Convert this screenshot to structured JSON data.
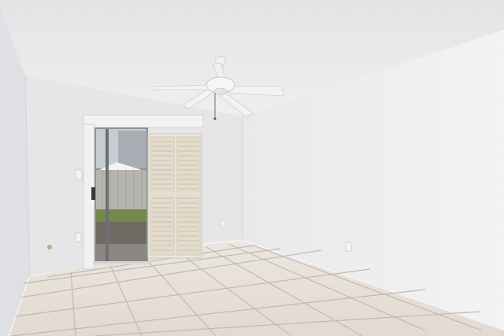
{
  "scene": {
    "description_free": true,
    "colors": {
      "ceiling": "#ececed",
      "wall_back": "#e7e7ea",
      "wall_right": "#eeeef0",
      "wall_left": "#dedfe2",
      "floor_tile": "#e6dfd6",
      "grout": "#b9b2aa",
      "trim": "#f2f2f2",
      "shutter": "#e9e3d6",
      "fence": "#b9b7b1",
      "grass": "#76894a",
      "sky": "#c7cdd3"
    },
    "icons": [
      "ceiling-fan-icon",
      "sliding-door-icon",
      "louvered-shutter-icon",
      "outlet-icon",
      "light-switch-icon"
    ]
  }
}
